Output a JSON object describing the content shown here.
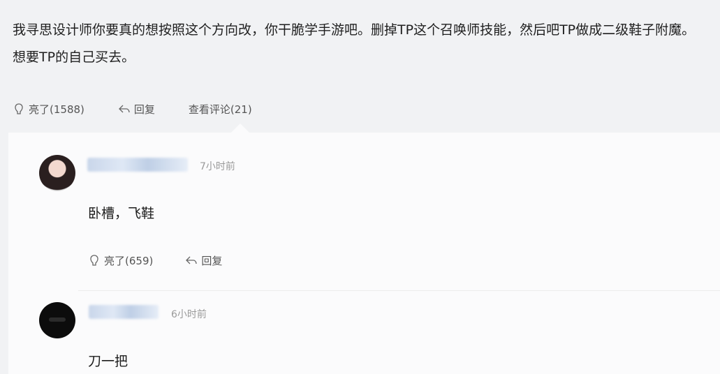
{
  "post": {
    "text": "我寻思设计师你要真的想按照这个方向改，你干脆学手游吧。删掉TP这个召唤师技能，然后吧TP做成二级鞋子附魔。想要TP的自己买去。",
    "like_label": "亮了(1588)",
    "reply_label": "回复",
    "view_comments_label": "查看评论(21)"
  },
  "comments": [
    {
      "time": "7小时前",
      "text": "卧槽，飞鞋",
      "like_label": "亮了(659)",
      "reply_label": "回复"
    },
    {
      "time": "6小时前",
      "text": "刀一把"
    }
  ],
  "icons": {
    "like": "thumbs-up-icon",
    "reply": "reply-arrow-icon"
  },
  "colors": {
    "background": "#f1f2f4",
    "panel": "#fbfbfc",
    "text": "#1f1f1f",
    "meta": "#9a9a9a"
  }
}
